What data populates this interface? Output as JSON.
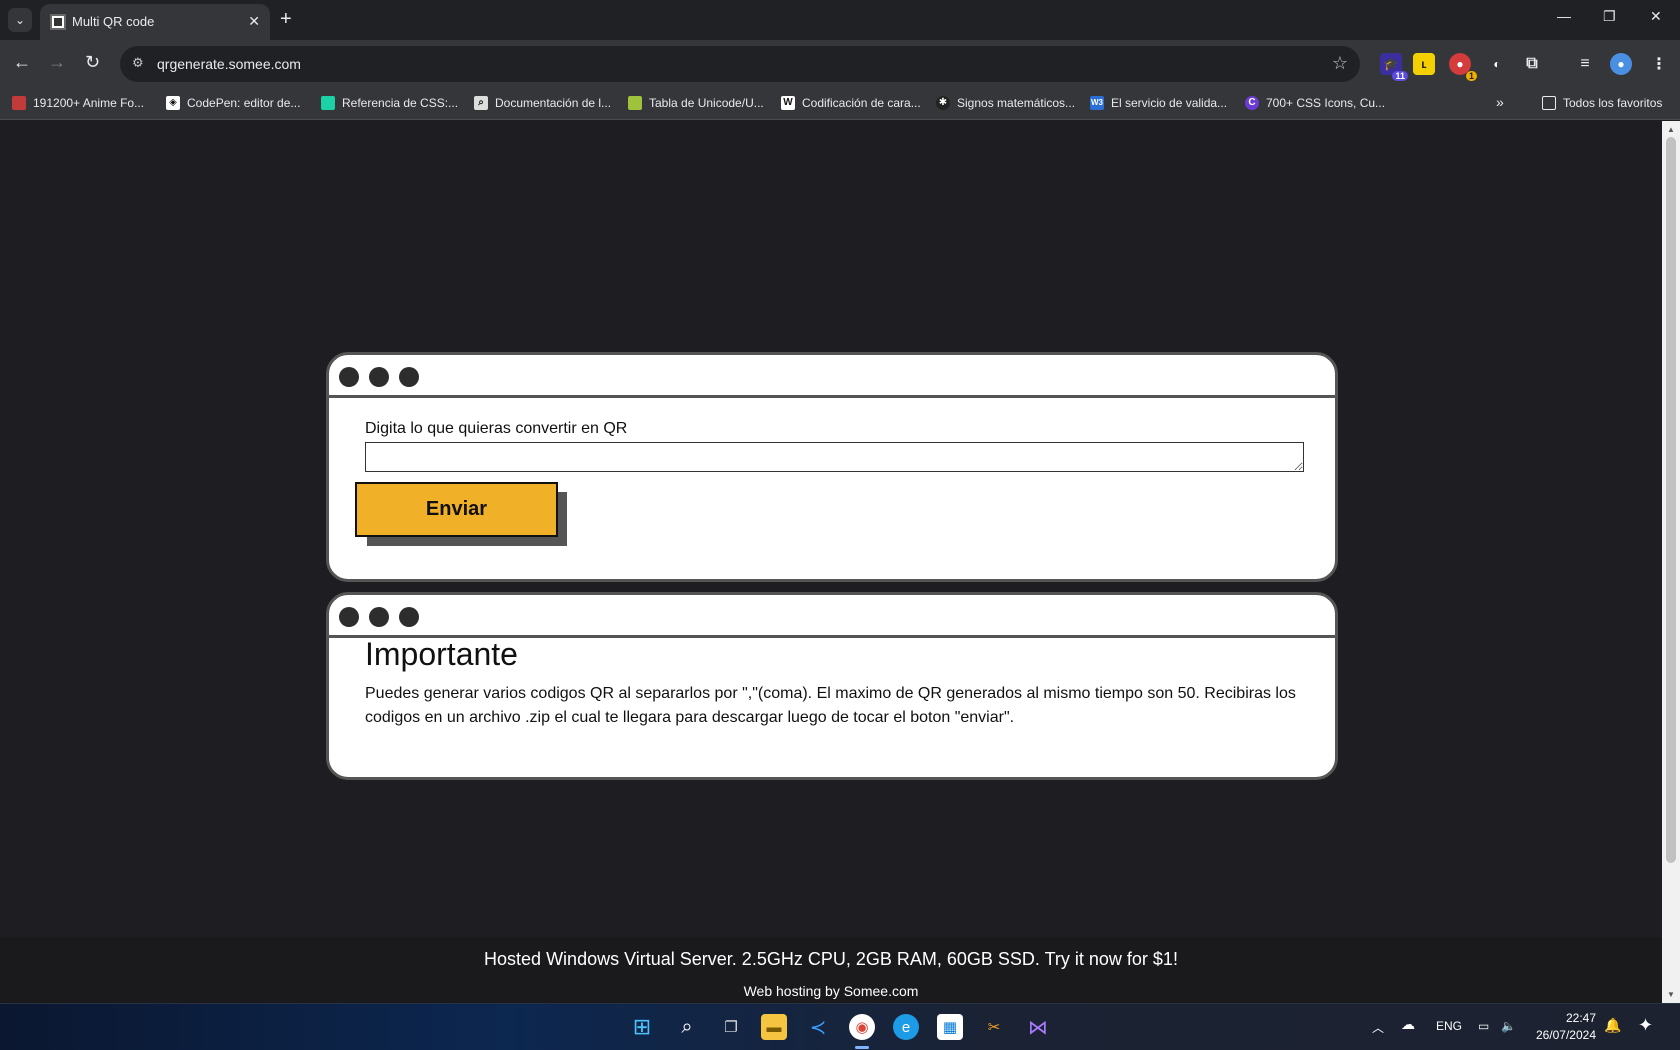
{
  "browser": {
    "tab_title": "Multi QR code",
    "url": "qrgenerate.somee.com",
    "tab_close": "✕",
    "new_tab": "+",
    "window_controls": {
      "minimize": "—",
      "restore": "❐",
      "close": "✕"
    },
    "nav": {
      "back": "←",
      "forward": "→",
      "reload": "↻"
    },
    "extensions": [
      {
        "icon": "graduation-cap-icon",
        "badge": "11"
      },
      {
        "icon": "lightning-icon",
        "badge": ""
      },
      {
        "icon": "record-icon",
        "badge": "1"
      },
      {
        "icon": "circle-half-icon",
        "badge": ""
      },
      {
        "icon": "puzzle-icon",
        "badge": ""
      },
      {
        "icon": "media-queue-icon",
        "badge": ""
      },
      {
        "icon": "profile-avatar-icon",
        "badge": ""
      },
      {
        "icon": "more-menu-icon",
        "badge": ""
      }
    ],
    "bookmarks": [
      {
        "label": "191200+ Anime Fo...",
        "icon_color": "#c23b3b",
        "glyph": ""
      },
      {
        "label": "CodePen: editor de...",
        "icon_color": "#ffffff",
        "glyph": "◈"
      },
      {
        "label": "Referencia de CSS:...",
        "icon_color": "#1bd1a5",
        "glyph": ""
      },
      {
        "label": "Documentación de l...",
        "icon_color": "#dddddd",
        "glyph": "⌕"
      },
      {
        "label": "Tabla de Unicode/U...",
        "icon_color": "#9ec23b",
        "glyph": ""
      },
      {
        "label": "Codificación de cara...",
        "icon_color": "#ffffff",
        "glyph": "W"
      },
      {
        "label": "Signos matemáticos...",
        "icon_color": "#222222",
        "glyph": "✱"
      },
      {
        "label": "El servicio de valida...",
        "icon_color": "#2b6fd6",
        "glyph": "W3"
      },
      {
        "label": "700+ CSS Icons, Cu...",
        "icon_color": "#6b3bd6",
        "glyph": "C"
      }
    ],
    "bookmarks_more": "»",
    "all_bookmarks": "Todos los favoritos"
  },
  "form_card": {
    "label": "Digita lo que quieras convertir en QR",
    "input_value": "",
    "button": "Enviar"
  },
  "info_card": {
    "title": "Importante",
    "text": "Puedes generar varios codigos QR al separarlos por \",\"(coma). El maximo de QR generados al mismo tiempo son 50. Recibiras los codigos en un archivo .zip el cual te llegara para descargar luego de tocar el boton \"enviar\"."
  },
  "footer": {
    "ad": "Hosted Windows Virtual Server. 2.5GHz CPU, 2GB RAM, 60GB SSD. Try it now for $1!",
    "hosting": "Web hosting by Somee.com"
  },
  "taskbar": {
    "apps": [
      "start-icon",
      "search-icon",
      "task-view-icon",
      "file-explorer-icon",
      "vscode-icon",
      "chrome-icon",
      "edge-icon",
      "store-icon",
      "snipping-tool-icon",
      "visual-studio-icon"
    ],
    "language": "ENG",
    "time": "22:47",
    "date": "26/07/2024"
  },
  "colors": {
    "page_bg": "#1e1e22",
    "button_bg": "#f0b027",
    "card_border": "#555555"
  }
}
